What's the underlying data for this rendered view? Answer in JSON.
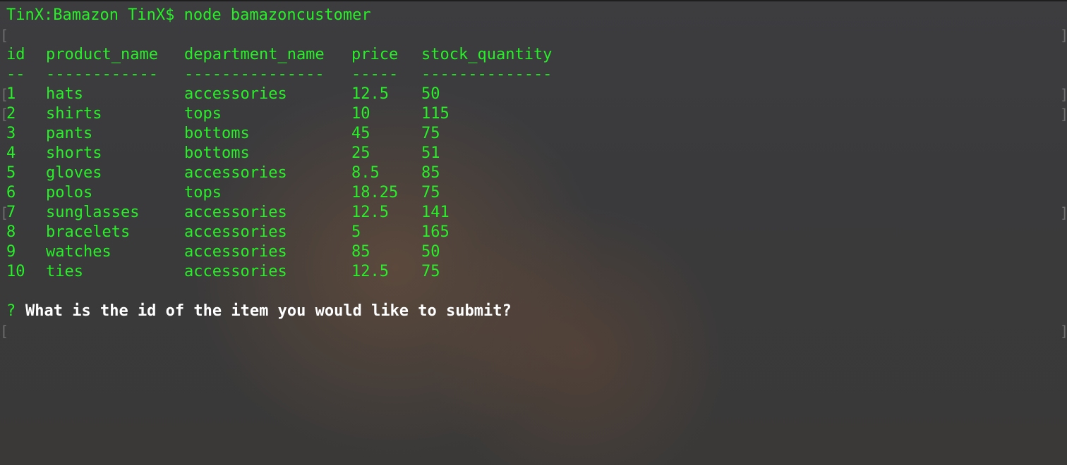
{
  "command_line": "TinX:Bamazon TinX$ node bamazoncustomer",
  "table": {
    "headers": [
      "id",
      "product_name",
      "department_name",
      "price",
      "stock_quantity"
    ],
    "separators": [
      "--",
      "------------",
      "---------------",
      "-----",
      "--------------"
    ],
    "rows": [
      {
        "id": "1",
        "product_name": "hats",
        "department_name": "accessories",
        "price": "12.5",
        "stock_quantity": "50"
      },
      {
        "id": "2",
        "product_name": "shirts",
        "department_name": "tops",
        "price": "10",
        "stock_quantity": "115"
      },
      {
        "id": "3",
        "product_name": "pants",
        "department_name": "bottoms",
        "price": "45",
        "stock_quantity": "75"
      },
      {
        "id": "4",
        "product_name": "shorts",
        "department_name": "bottoms",
        "price": "25",
        "stock_quantity": "51"
      },
      {
        "id": "5",
        "product_name": "gloves",
        "department_name": "accessories",
        "price": "8.5",
        "stock_quantity": "85"
      },
      {
        "id": "6",
        "product_name": "polos",
        "department_name": "tops",
        "price": "18.25",
        "stock_quantity": "75"
      },
      {
        "id": "7",
        "product_name": "sunglasses",
        "department_name": "accessories",
        "price": "12.5",
        "stock_quantity": "141"
      },
      {
        "id": "8",
        "product_name": "bracelets",
        "department_name": "accessories",
        "price": "5",
        "stock_quantity": "165"
      },
      {
        "id": "9",
        "product_name": "watches",
        "department_name": "accessories",
        "price": "85",
        "stock_quantity": "50"
      },
      {
        "id": "10",
        "product_name": "ties",
        "department_name": "accessories",
        "price": "12.5",
        "stock_quantity": "75"
      }
    ]
  },
  "prompt": {
    "marker": "?",
    "question": "What is the id of the item you would like to submit?"
  },
  "colors": {
    "terminal_green": "#28f028",
    "prompt_white": "#ffffff",
    "bracket_gray": "#6f6f6f"
  }
}
